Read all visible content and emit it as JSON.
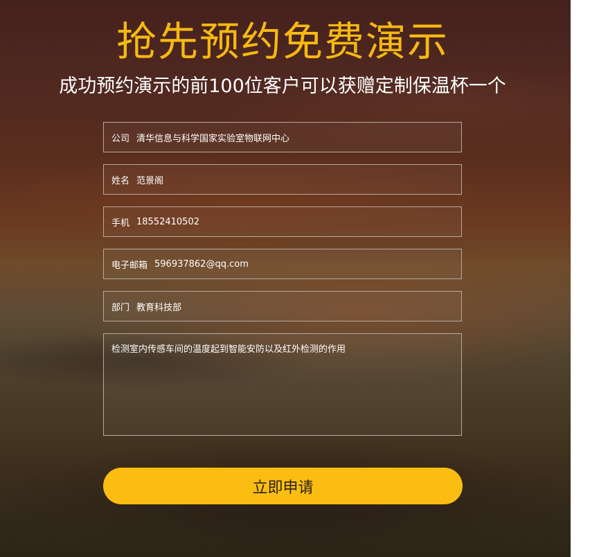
{
  "header": {
    "title": "抢先预约免费演示",
    "subtitle": "成功预约演示的前100位客户可以获赠定制保温杯一个"
  },
  "form": {
    "fields": [
      {
        "label": "公司",
        "value": "清华信息与科学国家实验室物联网中心"
      },
      {
        "label": "姓名",
        "value": "范景阁"
      },
      {
        "label": "手机",
        "value": "18552410502"
      },
      {
        "label": "电子邮箱",
        "value": "596937862@qq.com"
      },
      {
        "label": "部门",
        "value": "教育科技部"
      }
    ],
    "message": "检测室内传感车间的温度起到智能安防以及红外检测的作用",
    "submit_label": "立即申请"
  },
  "colors": {
    "accent": "#fbbd11",
    "title": "#f5b912",
    "text": "#ffffff"
  }
}
